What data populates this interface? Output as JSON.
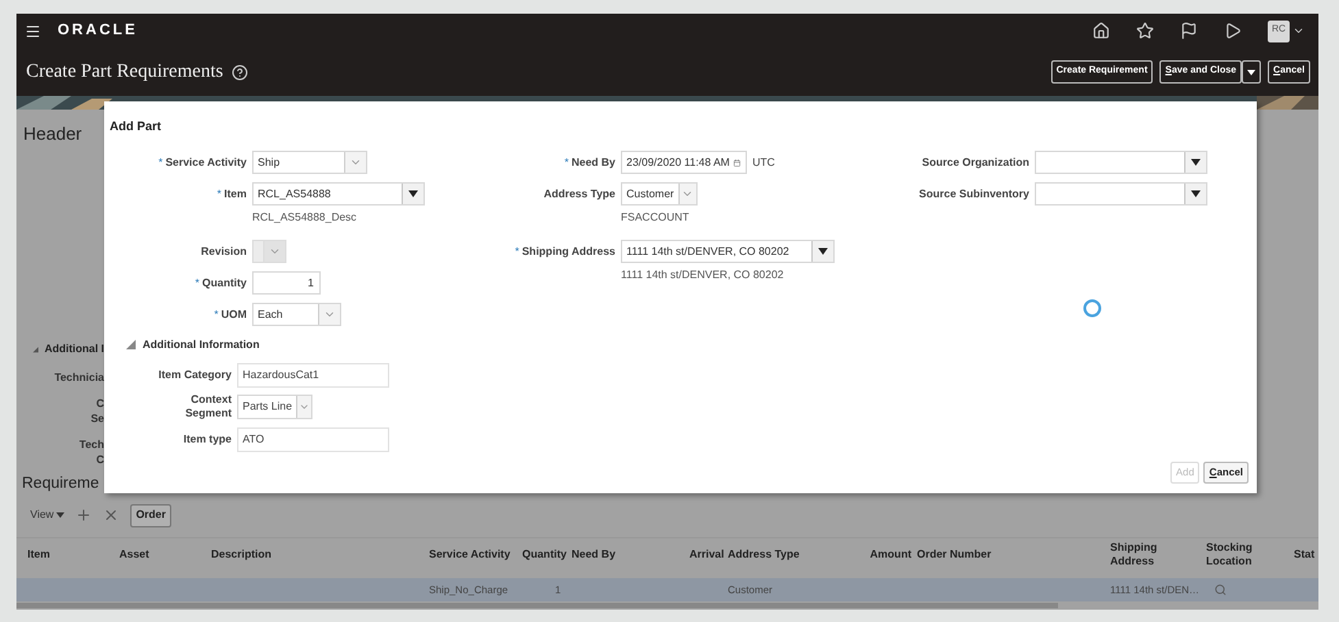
{
  "app_bar": {
    "brand": "ORACLE",
    "user_initials": "RC"
  },
  "page_header": {
    "title": "Create Part Requirements",
    "buttons": [
      {
        "label": "Create Requirement",
        "mnemonic": false,
        "menu": false
      },
      {
        "label": "Save and Close",
        "mnemonic": true,
        "menu": true
      },
      {
        "label": "Cancel",
        "mnemonic": true,
        "menu": false
      }
    ]
  },
  "background": {
    "section_title": "Header",
    "subsection": "Additional I",
    "labels": [
      [
        "Technicia"
      ],
      [
        "C",
        "Se"
      ],
      [
        "Tech",
        "C"
      ]
    ]
  },
  "dialog": {
    "title": "Add Part",
    "columns": [
      [
        {
          "kind": "select",
          "label": "Service Activity",
          "required_mark": "*",
          "value": "Ship",
          "disabled": false
        },
        {
          "kind": "lov",
          "label": "Item",
          "required_mark": "*",
          "value": "RCL_AS54888",
          "note": "RCL_AS54888_Desc",
          "disabled": false
        },
        {
          "kind": "select",
          "label": "Revision",
          "disabled": true
        },
        {
          "kind": "number",
          "label": "Quantity",
          "required_mark": "*",
          "value": "1",
          "disabled": false
        },
        {
          "kind": "select",
          "label": "UOM",
          "required_mark": "*",
          "value": "Each",
          "disabled": false
        }
      ],
      [
        {
          "kind": "date",
          "label": "Need By",
          "required_mark": "*",
          "value": "23/09/2020 11:48 AM",
          "suffix": "UTC",
          "disabled": false
        },
        {
          "kind": "select",
          "label": "Address Type",
          "value": "Customer",
          "note": "FSACCOUNT",
          "disabled": false
        },
        {
          "kind": "lov",
          "label": "Shipping Address",
          "required_mark": "*",
          "value": "1111 14th st/DENVER, CO 80202",
          "note": "1111 14th st/DENVER, CO 80202",
          "disabled": false
        }
      ],
      [
        {
          "kind": "lov",
          "label": "Source Organization",
          "disabled": false
        },
        {
          "kind": "lov",
          "label": "Source Subinventory",
          "disabled": false
        }
      ]
    ],
    "additional_information": {
      "title": "Additional Information",
      "expanded": true,
      "fields": [
        {
          "kind": "text",
          "label": [
            "Item Category"
          ],
          "value": "HazardousCat1"
        },
        {
          "kind": "select",
          "label": [
            "Context Segment"
          ],
          "value": "Parts Line"
        },
        {
          "kind": "text",
          "label": [
            "Item type"
          ],
          "value": "ATO"
        }
      ]
    },
    "loading": true,
    "buttons": [
      {
        "label": "Add",
        "disabled": true,
        "mnemonic": false
      },
      {
        "label": "Cancel",
        "disabled": false,
        "mnemonic": true
      }
    ]
  },
  "requirements": {
    "title": "Requireme",
    "toolbar": {
      "view": "View",
      "order": "Order"
    },
    "columns": [
      "Item",
      "Asset",
      "Description",
      "Service Activity",
      "Quantity",
      "Need By",
      "Arrival",
      "Address Type",
      "Amount",
      "Order Number",
      "Shipping Address",
      "Stocking Location",
      "Stat"
    ],
    "rows": [
      {
        "selected": true,
        "cells": [
          "",
          "",
          "",
          "Ship_No_Charge",
          "1",
          "",
          "",
          "Customer",
          "",
          "",
          "1111 14th st/DEN…",
          "",
          ""
        ],
        "stocking_search": true
      }
    ]
  }
}
